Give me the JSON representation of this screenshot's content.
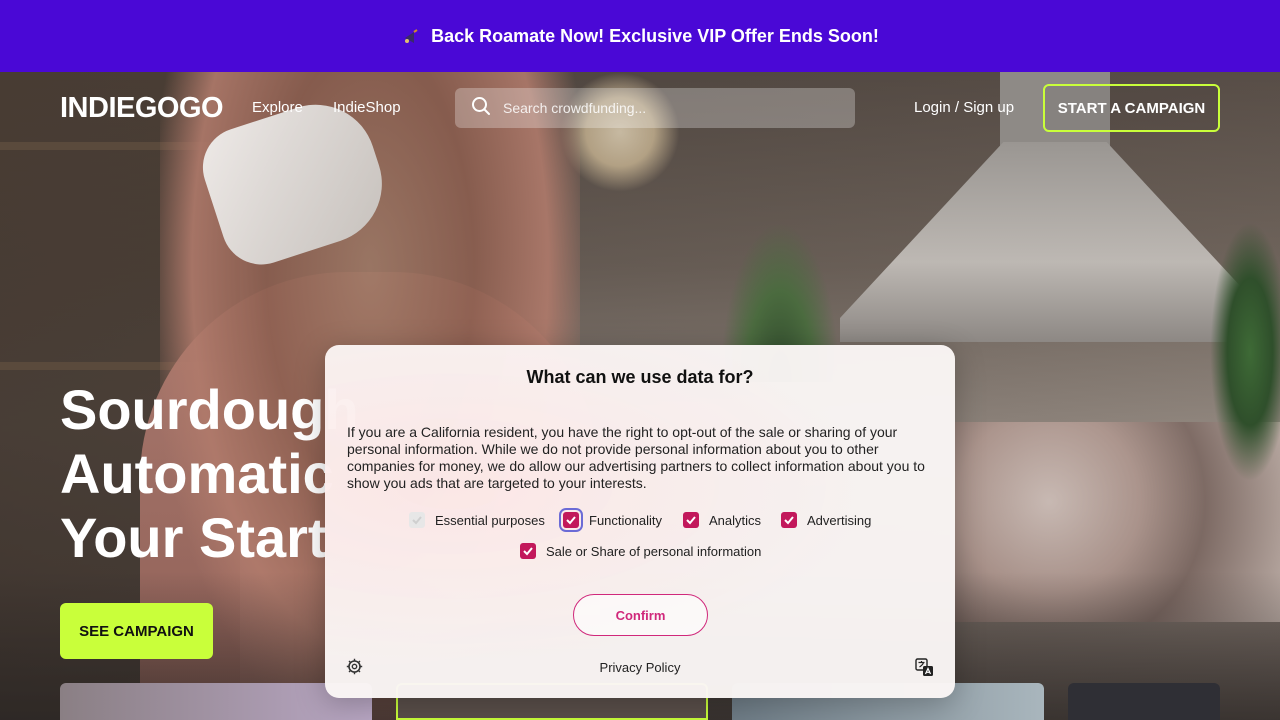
{
  "promo": {
    "icon": "megaphone-icon",
    "text": "Back Roamate Now! Exclusive VIP Offer Ends Soon!",
    "bg_color": "#4a08d6"
  },
  "nav": {
    "logo": "INDIEGOGO",
    "links": [
      "Explore",
      "IndieShop"
    ],
    "search_placeholder": "Search crowdfunding...",
    "login": "Login / Sign up",
    "start_campaign": "START A CAMPAIGN",
    "accent_color": "#c9ff3a"
  },
  "hero": {
    "title": "Sourdough\nAutomatic\nYour Start",
    "cta": "SEE CAMPAIGN"
  },
  "consent": {
    "title": "What can we use data for?",
    "body": "If you are a California resident, you have the right to opt-out of the sale or sharing of your personal information. While we do not provide personal information about you to other companies for money, we do allow our advertising partners to collect information about you to show you ads that are targeted to your interests.",
    "options": [
      {
        "label": "Essential purposes",
        "checked": true,
        "disabled": true
      },
      {
        "label": "Functionality",
        "checked": true,
        "disabled": false
      },
      {
        "label": "Analytics",
        "checked": true,
        "disabled": false
      },
      {
        "label": "Advertising",
        "checked": true,
        "disabled": false
      },
      {
        "label": "Sale or Share of personal information",
        "checked": true,
        "disabled": false
      }
    ],
    "confirm": "Confirm",
    "privacy_link": "Privacy Policy",
    "check_color": "#c2185b",
    "settings_icon": "gear-icon",
    "language_icon": "translate-icon"
  }
}
